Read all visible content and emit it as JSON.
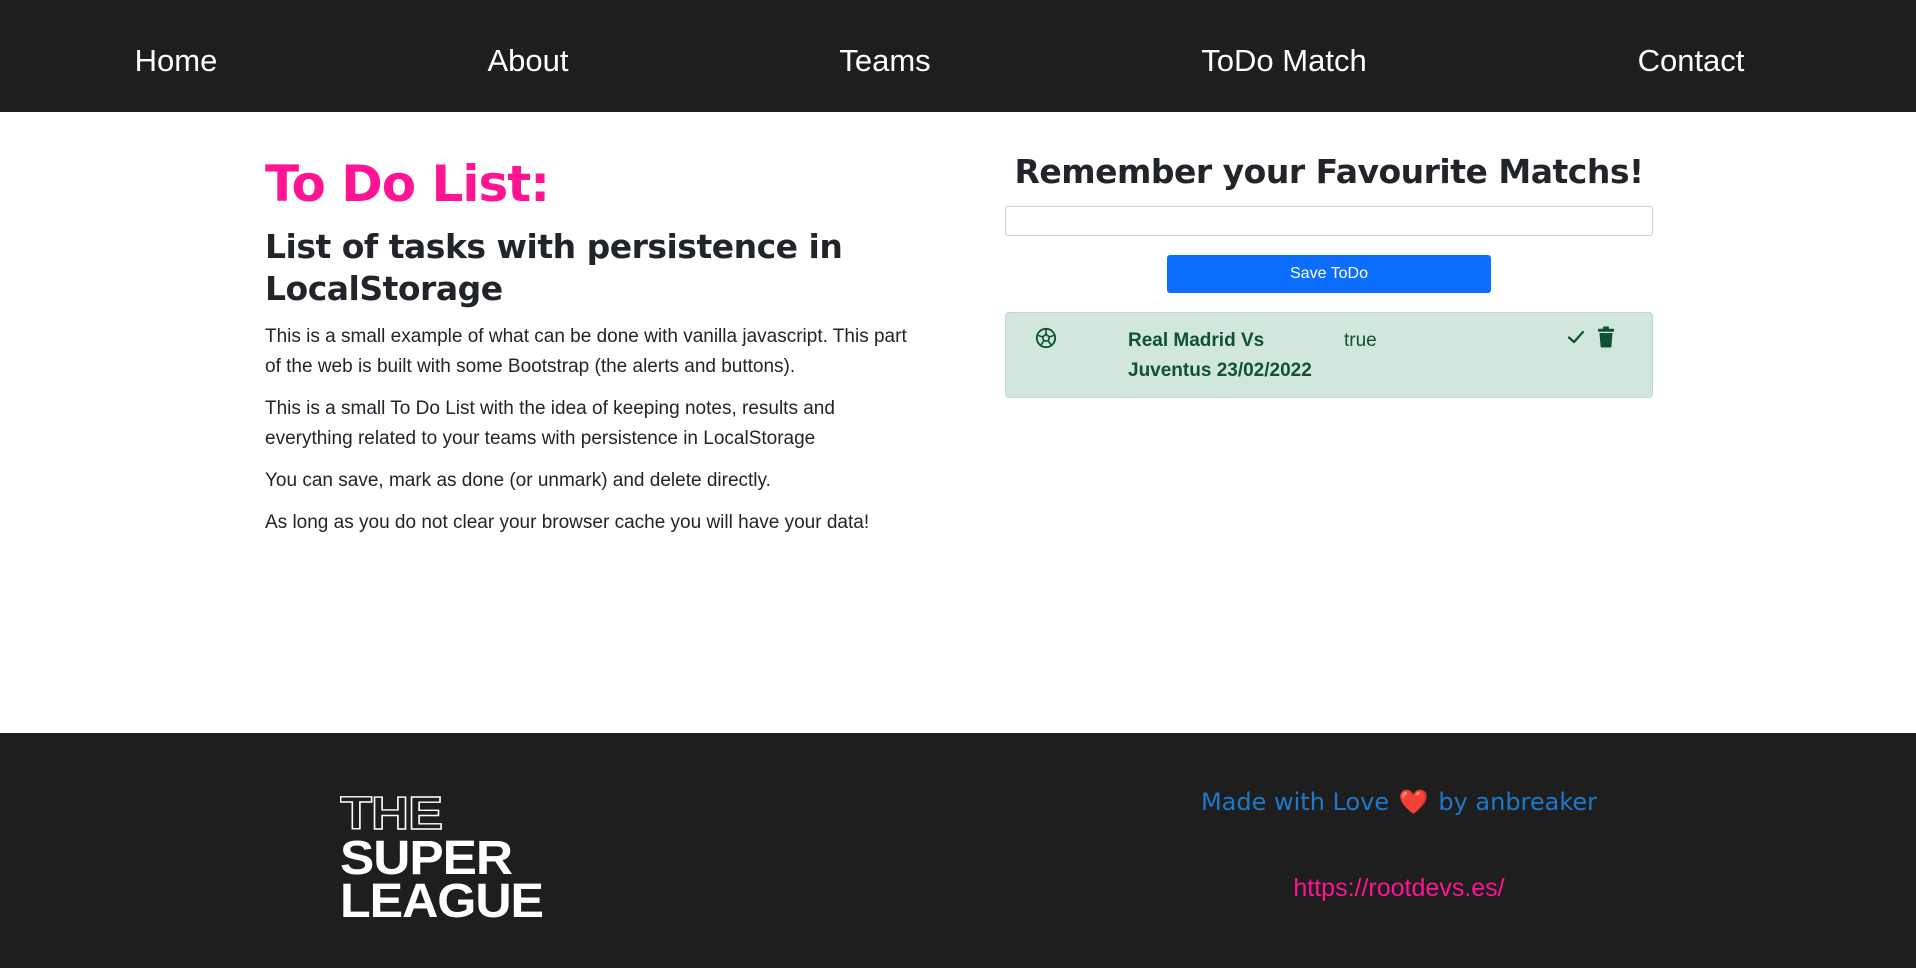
{
  "nav": {
    "items": [
      {
        "label": "Home"
      },
      {
        "label": "About"
      },
      {
        "label": "Teams"
      },
      {
        "label": "ToDo Match"
      },
      {
        "label": "Contact"
      }
    ]
  },
  "intro": {
    "title": "To Do List:",
    "subtitle": "List of tasks with persistence in LocalStorage",
    "paragraphs": [
      "This is a small example of what can be done with vanilla javascript. This part of the web is built with some Bootstrap (the alerts and buttons).",
      "This is a small To Do List with the idea of keeping notes, results and everything related to your teams with persistence in LocalStorage",
      "You can save, mark as done (or unmark) and delete directly.",
      "As long as you do not clear your browser cache you will have your data!"
    ]
  },
  "todo": {
    "heading": "Remember your Favourite Matchs!",
    "input_value": "",
    "save_label": "Save ToDo",
    "items": [
      {
        "icon": "football-icon",
        "text": "Real Madrid Vs Juventus 23/02/2022",
        "status": "true",
        "actions": [
          "check-icon",
          "trash-icon"
        ]
      }
    ]
  },
  "footer": {
    "logo_text": [
      "THE",
      "SUPER",
      "LEAGUE"
    ],
    "made_prefix": "Made with Love",
    "made_suffix": "by anbreaker",
    "heart": "❤️",
    "site_link": "https://rootdevs.es/"
  },
  "colors": {
    "nav_bg": "#1e1e1e",
    "title_pink": "#ff1493",
    "button_blue": "#0d6efd",
    "alert_green_bg": "#d1e7dd",
    "alert_green_text": "#0f5132",
    "footer_link_blue": "#1f78c8"
  }
}
